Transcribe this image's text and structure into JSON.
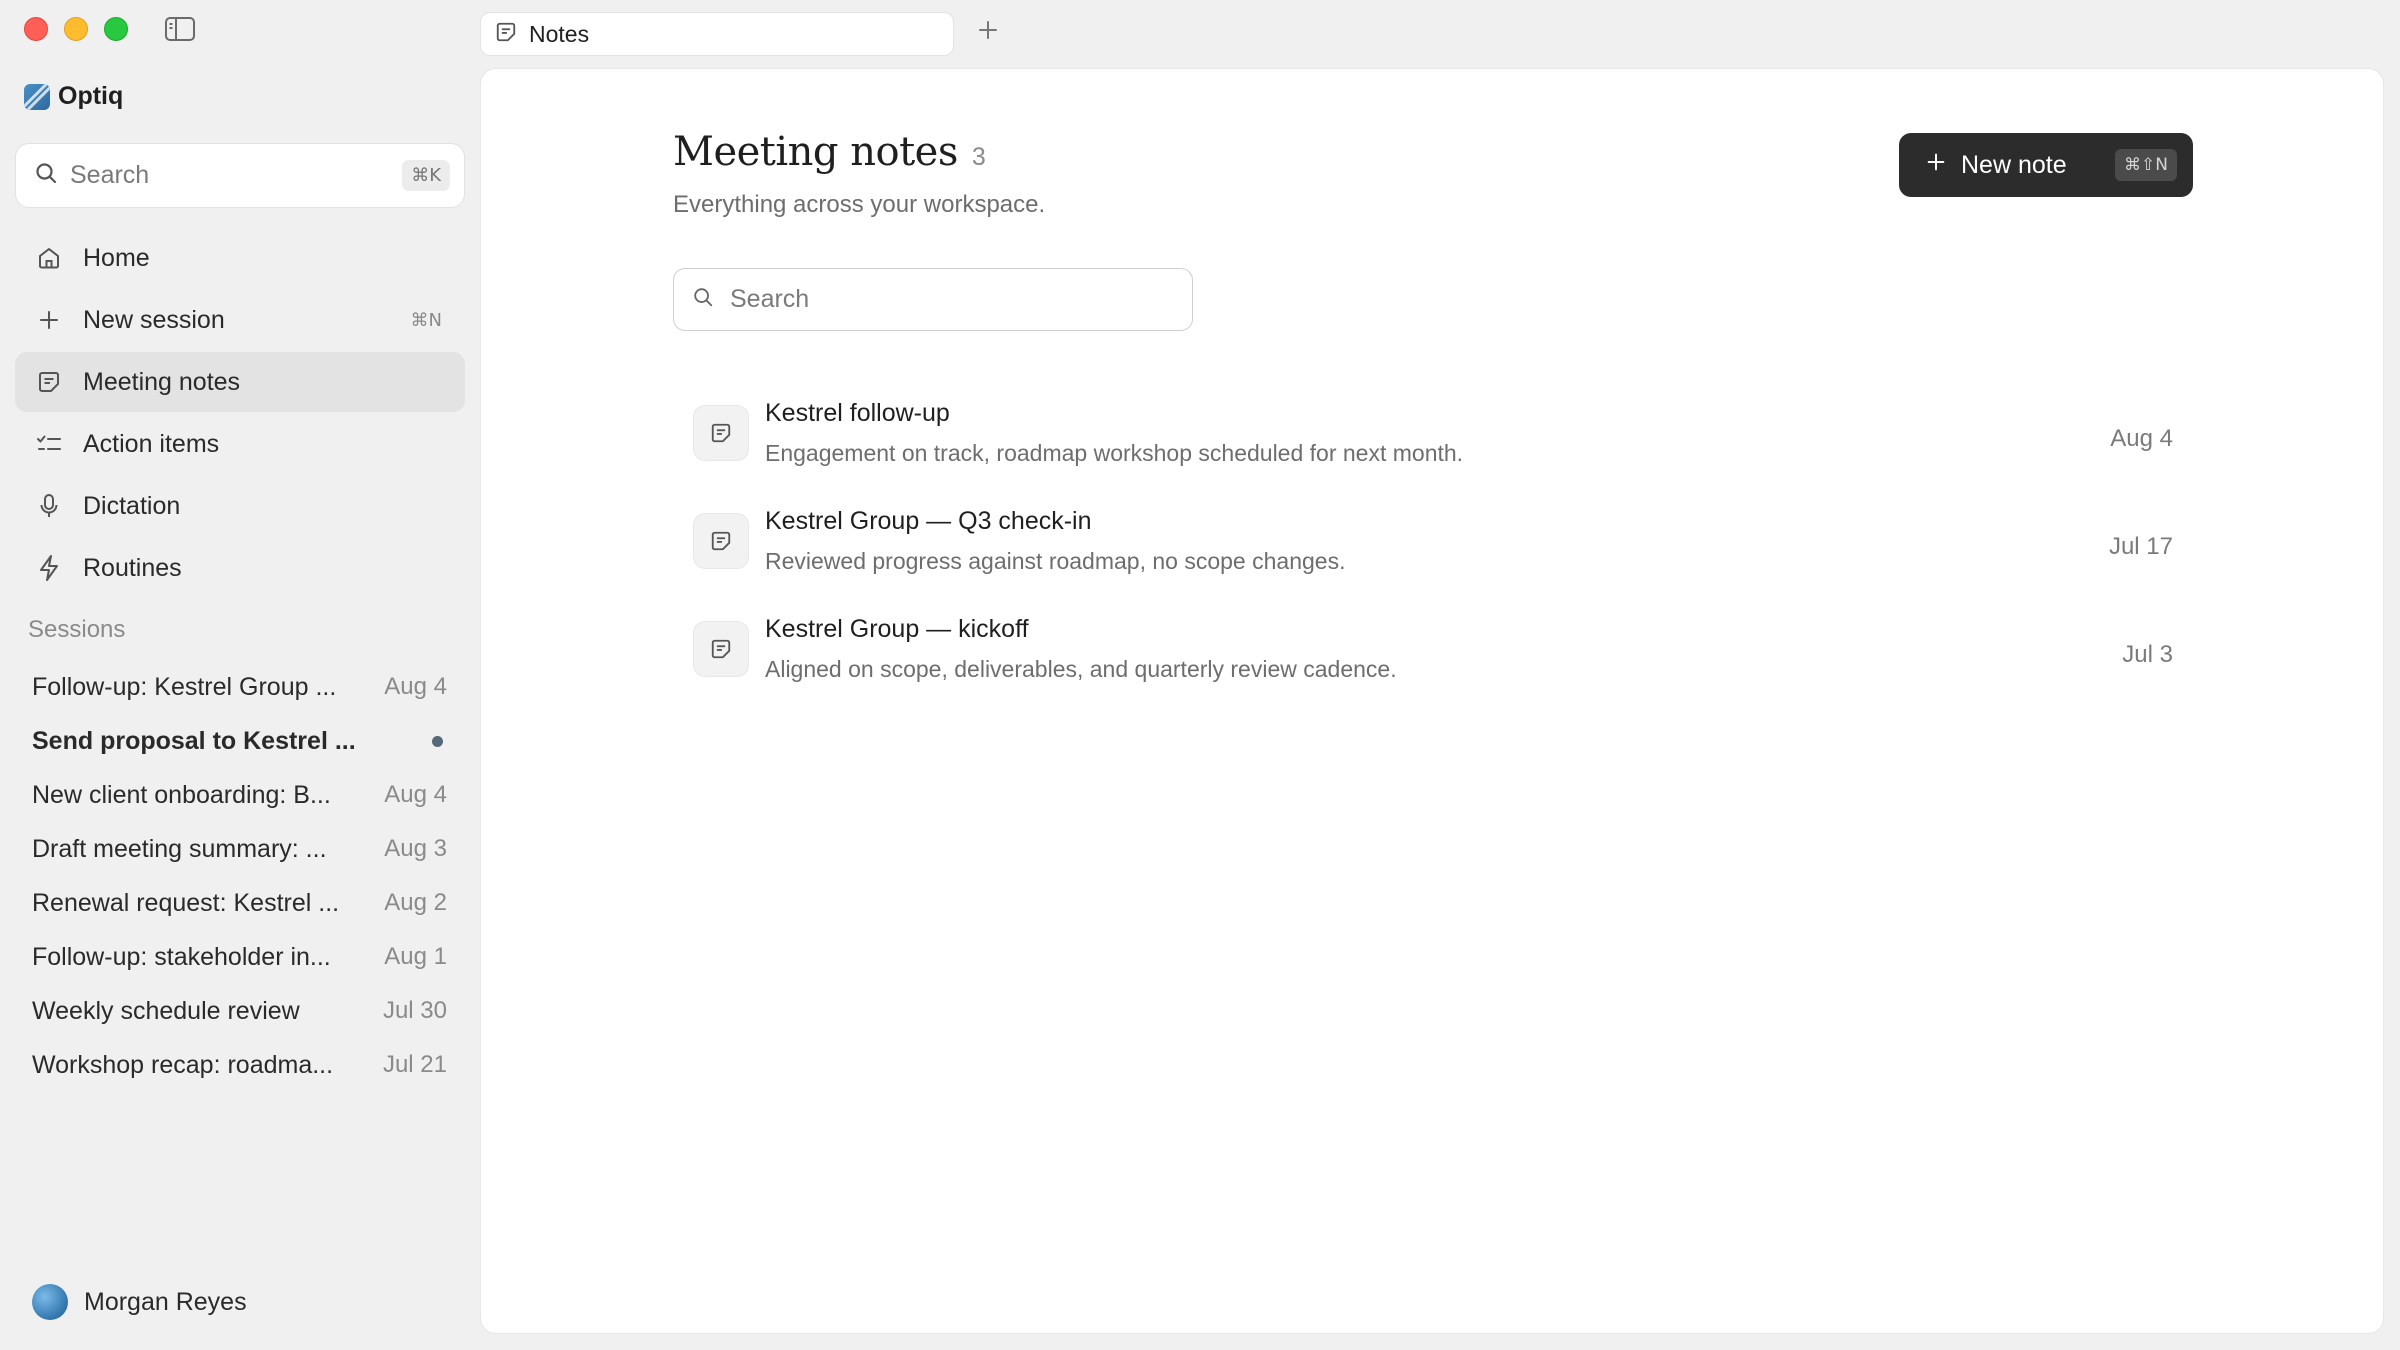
{
  "app": {
    "name": "Optiq"
  },
  "tabs": [
    {
      "label": "Notes"
    }
  ],
  "sidebar": {
    "search": {
      "placeholder": "Search",
      "shortcut": "⌘K"
    },
    "nav": [
      {
        "label": "Home",
        "icon": "home-icon"
      },
      {
        "label": "New session",
        "icon": "plus-icon",
        "shortcut": "⌘N"
      },
      {
        "label": "Meeting notes",
        "icon": "note-icon",
        "active": true
      },
      {
        "label": "Action items",
        "icon": "checklist-icon"
      },
      {
        "label": "Dictation",
        "icon": "microphone-icon"
      },
      {
        "label": "Routines",
        "icon": "bolt-icon"
      }
    ],
    "sessions_heading": "Sessions",
    "sessions": [
      {
        "title": "Follow-up: Kestrel Group ...",
        "date": "Aug 4"
      },
      {
        "title": "Send proposal to Kestrel ...",
        "date": "",
        "unread": true
      },
      {
        "title": "New client onboarding: B...",
        "date": "Aug 4"
      },
      {
        "title": "Draft meeting summary: ...",
        "date": "Aug 3"
      },
      {
        "title": "Renewal request: Kestrel ...",
        "date": "Aug 2"
      },
      {
        "title": "Follow-up: stakeholder in...",
        "date": "Aug 1"
      },
      {
        "title": "Weekly schedule review",
        "date": "Jul 30"
      },
      {
        "title": "Workshop recap: roadma...",
        "date": "Jul 21"
      }
    ],
    "user": {
      "name": "Morgan Reyes"
    }
  },
  "main": {
    "title": "Meeting notes",
    "count": "3",
    "subtitle": "Everything across your workspace.",
    "new_note": {
      "label": "New note",
      "shortcut": "⌘⇧N"
    },
    "search": {
      "placeholder": "Search"
    },
    "notes": [
      {
        "title": "Kestrel follow-up",
        "description": "Engagement on track, roadmap workshop scheduled for next month.",
        "date": "Aug 4"
      },
      {
        "title": "Kestrel Group — Q3 check-in",
        "description": "Reviewed progress against roadmap, no scope changes.",
        "date": "Jul 17"
      },
      {
        "title": "Kestrel Group — kickoff",
        "description": "Aligned on scope, deliverables, and quarterly review cadence.",
        "date": "Jul 3"
      }
    ]
  },
  "colors": {
    "accent_dark": "#2c2c2c",
    "unread_dot": "#55697a"
  }
}
